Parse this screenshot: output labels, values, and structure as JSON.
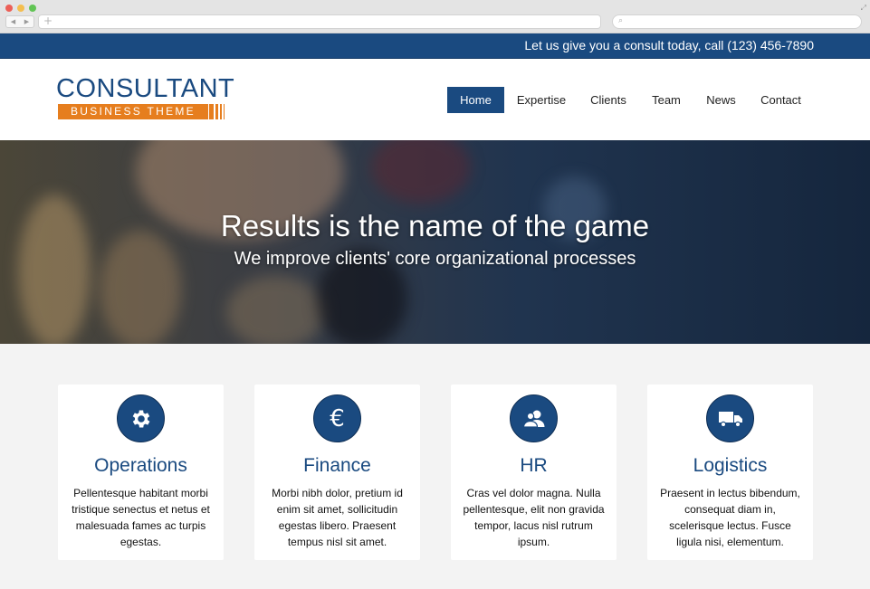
{
  "topbar": {
    "text": "Let us give you a consult today, call (123) 456-7890"
  },
  "logo": {
    "title": "CONSULTANT",
    "subtitle": "BUSINESS THEME"
  },
  "nav": {
    "items": [
      {
        "label": "Home",
        "active": true
      },
      {
        "label": "Expertise",
        "active": false
      },
      {
        "label": "Clients",
        "active": false
      },
      {
        "label": "Team",
        "active": false
      },
      {
        "label": "News",
        "active": false
      },
      {
        "label": "Contact",
        "active": false
      }
    ]
  },
  "hero": {
    "title": "Results is the name of the game",
    "subtitle": "We improve clients' core organizational processes"
  },
  "cards": [
    {
      "icon": "gear-icon",
      "title": "Operations",
      "text": "Pellentesque habitant morbi tristique senectus et netus et malesuada fames ac turpis egestas."
    },
    {
      "icon": "euro-icon",
      "title": "Finance",
      "text": "Morbi nibh dolor, pretium id enim sit amet, sollicitudin egestas libero. Praesent tempus nisl sit amet."
    },
    {
      "icon": "users-icon",
      "title": "HR",
      "text": "Cras vel dolor magna. Nulla pellentesque, elit non gravida tempor, lacus nisl rutrum ipsum."
    },
    {
      "icon": "truck-icon",
      "title": "Logistics",
      "text": "Praesent in lectus bibendum, consequat diam in, scelerisque lectus. Fusce ligula nisi, elementum."
    }
  ],
  "colors": {
    "primary": "#1a4a80",
    "accent": "#e67e1e"
  }
}
